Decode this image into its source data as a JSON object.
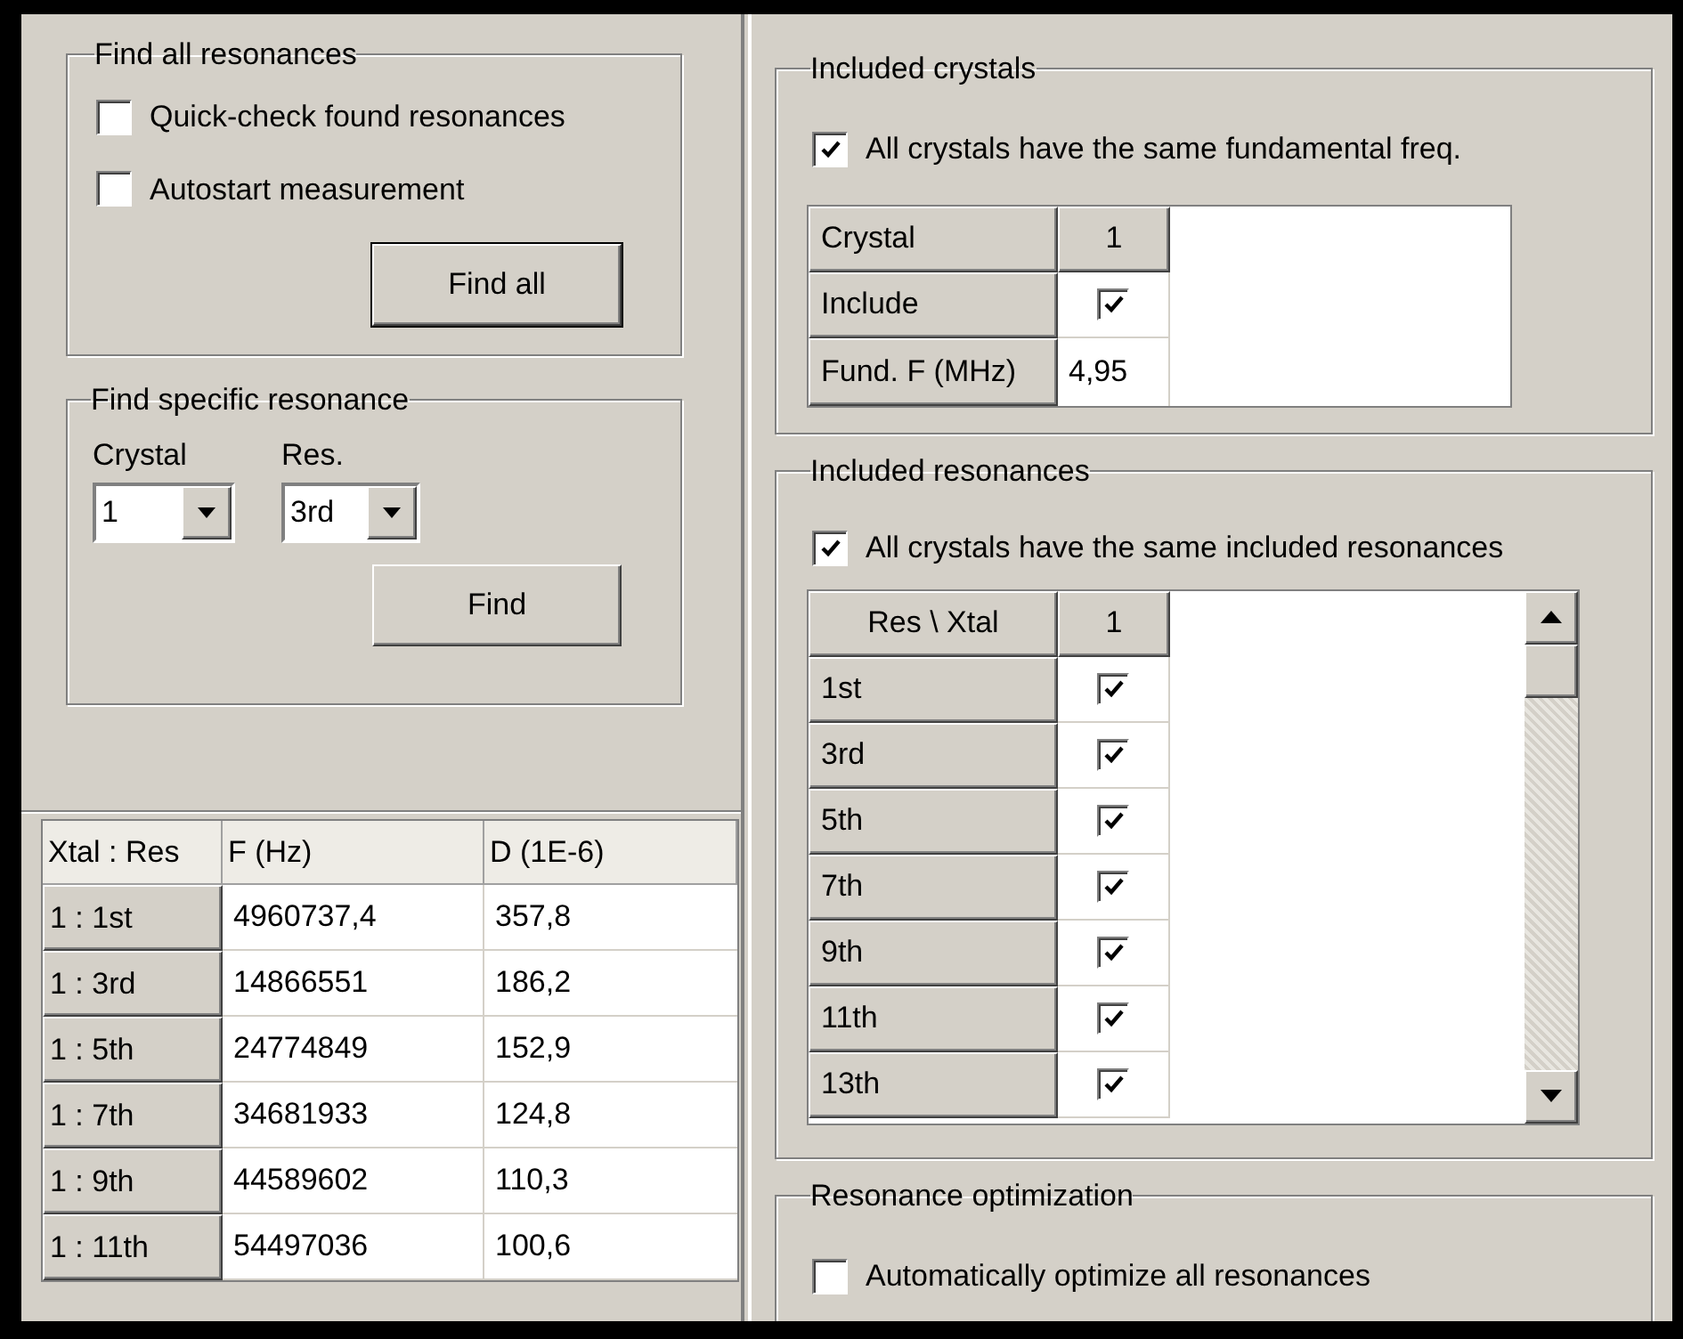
{
  "find_all": {
    "title": "Find all resonances",
    "options": [
      {
        "label": "Quick-check found resonances",
        "checked": false
      },
      {
        "label": "Autostart measurement",
        "checked": false
      }
    ],
    "button": {
      "label": "Find all",
      "default": true
    }
  },
  "find_specific": {
    "title": "Find specific resonance",
    "fields": [
      {
        "label": "Crystal",
        "value": "1"
      },
      {
        "label": "Res.",
        "value": "3rd"
      }
    ],
    "button": {
      "label": "Find",
      "default": false
    }
  },
  "results": {
    "columns": [
      "Xtal : Res",
      "F (Hz)",
      "D (1E-6)"
    ],
    "rows": [
      {
        "key": "1 : 1st",
        "f": "4960737,4",
        "d": "357,8"
      },
      {
        "key": "1 : 3rd",
        "f": "14866551",
        "d": "186,2"
      },
      {
        "key": "1 : 5th",
        "f": "24774849",
        "d": "152,9"
      },
      {
        "key": "1 : 7th",
        "f": "34681933",
        "d": "124,8"
      },
      {
        "key": "1 : 9th",
        "f": "44589602",
        "d": "110,3"
      },
      {
        "key": "1 : 11th",
        "f": "54497036",
        "d": "100,6"
      }
    ]
  },
  "included_crystals": {
    "title": "Included crystals",
    "same": {
      "label": "All crystals have the same fundamental freq.",
      "checked": true
    },
    "grid": {
      "header": "Crystal",
      "column": "1",
      "include_label": "Include",
      "include": true,
      "freq_label": "Fund. F (MHz)",
      "freq": "4,95"
    }
  },
  "included_resonances": {
    "title": "Included resonances",
    "same": {
      "label": "All crystals have the same included resonances",
      "checked": true
    },
    "grid": {
      "header": "Res \\ Xtal",
      "column": "1",
      "rows": [
        {
          "label": "1st",
          "checked": true
        },
        {
          "label": "3rd",
          "checked": true
        },
        {
          "label": "5th",
          "checked": true
        },
        {
          "label": "7th",
          "checked": true
        },
        {
          "label": "9th",
          "checked": true
        },
        {
          "label": "11th",
          "checked": true
        },
        {
          "label": "13th",
          "checked": true
        }
      ]
    }
  },
  "optimization": {
    "title": "Resonance optimization",
    "auto": {
      "label": "Automatically optimize all resonances",
      "checked": false
    }
  }
}
